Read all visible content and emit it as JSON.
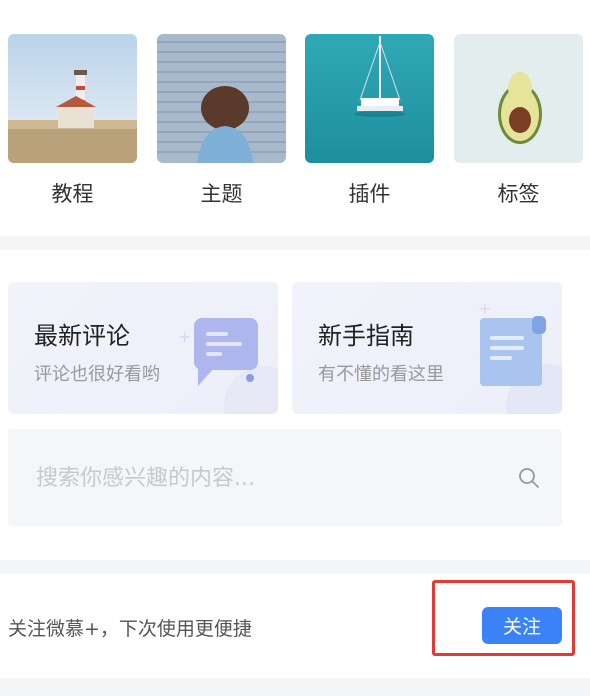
{
  "categories": [
    {
      "label": "教程",
      "image": "lighthouse"
    },
    {
      "label": "主题",
      "image": "person-wall"
    },
    {
      "label": "插件",
      "image": "sailboat"
    },
    {
      "label": "标签",
      "image": "avocado"
    }
  ],
  "cards": [
    {
      "title": "最新评论",
      "subtitle": "评论也很好看哟",
      "icon": "chat-bubble-icon"
    },
    {
      "title": "新手指南",
      "subtitle": "有不懂的看这里",
      "icon": "document-icon"
    }
  ],
  "search": {
    "placeholder": "搜索你感兴趣的内容..."
  },
  "follow": {
    "text": "关注微慕+，下次使用更便捷",
    "button_label": "关注"
  },
  "colors": {
    "accent": "#3b82f6",
    "highlight": "#e53935",
    "separator": "#f4f5f7"
  }
}
